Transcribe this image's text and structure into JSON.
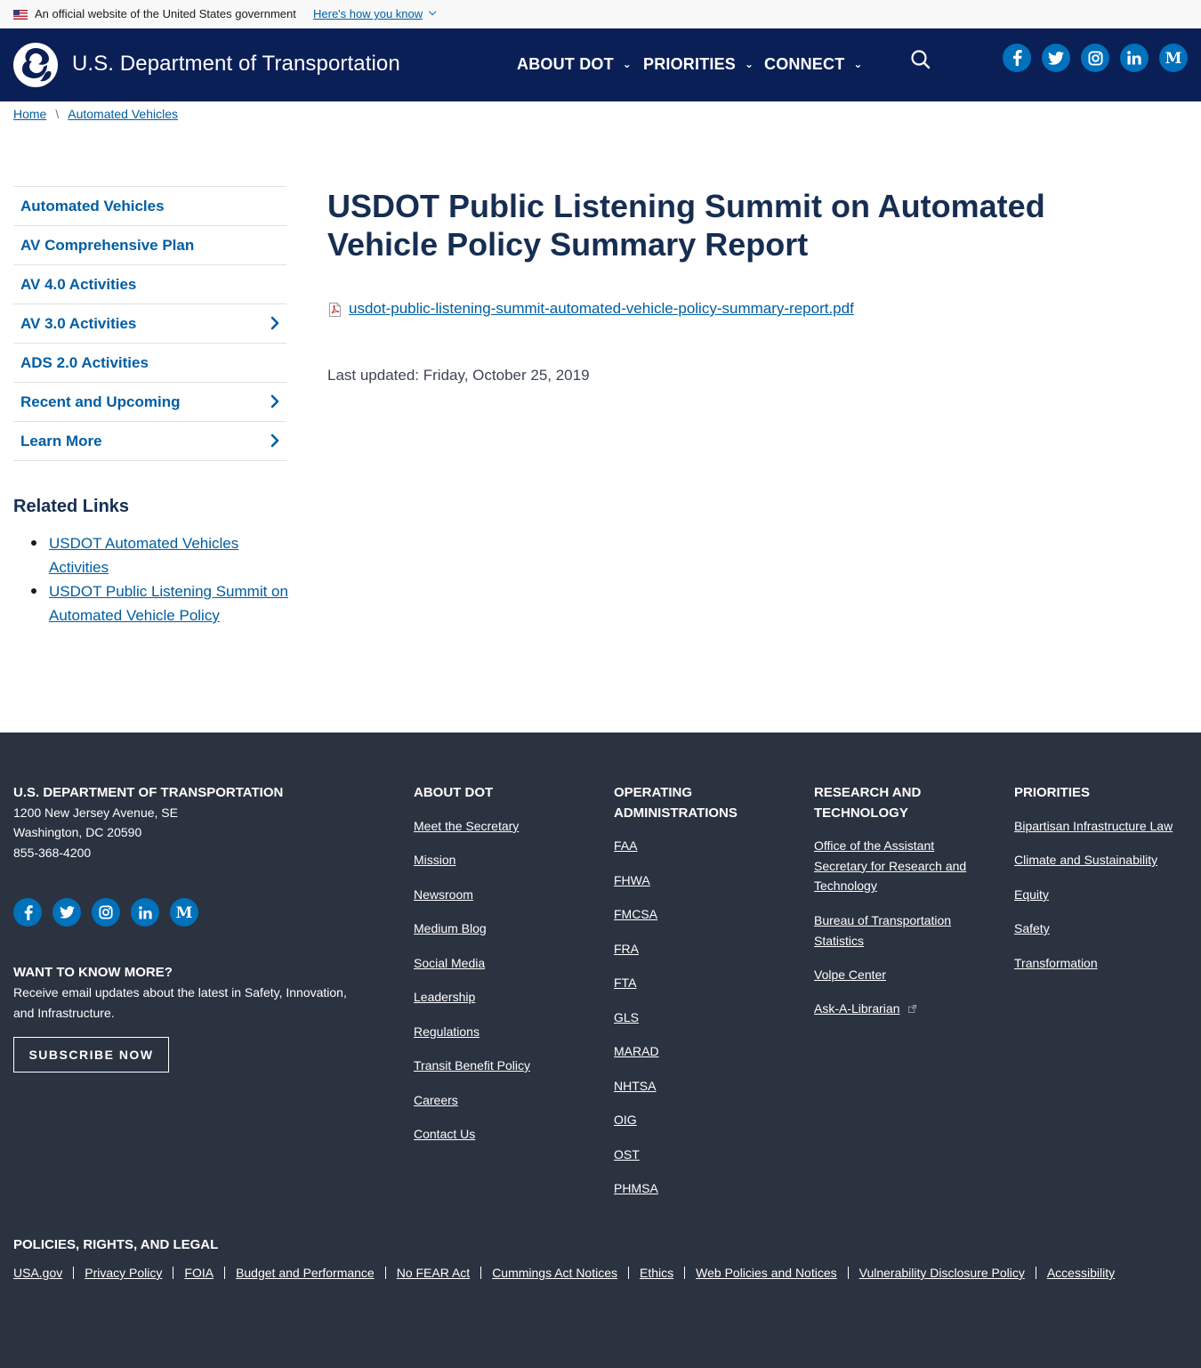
{
  "gov_banner": {
    "official_text": "An official website of the United States government",
    "how_link": "Here's how you know"
  },
  "header": {
    "site_name": "U.S. Department of Transportation",
    "nav": [
      "ABOUT DOT",
      "PRIORITIES",
      "CONNECT"
    ],
    "social": [
      "facebook-icon",
      "twitter-icon",
      "instagram-icon",
      "linkedin-icon",
      "medium-icon"
    ]
  },
  "breadcrumb": {
    "home": "Home",
    "current": "Automated Vehicles"
  },
  "sidebar": {
    "items": [
      {
        "label": "Automated Vehicles",
        "has_children": false
      },
      {
        "label": "AV Comprehensive Plan",
        "has_children": false
      },
      {
        "label": "AV 4.0 Activities",
        "has_children": false
      },
      {
        "label": "AV 3.0 Activities",
        "has_children": true
      },
      {
        "label": "ADS 2.0 Activities",
        "has_children": false
      },
      {
        "label": "Recent and Upcoming",
        "has_children": true
      },
      {
        "label": "Learn More",
        "has_children": true
      }
    ],
    "related_title": "Related Links",
    "related_links": [
      "USDOT Automated Vehicles Activities",
      "USDOT Public Listening Summit on Automated Vehicle Policy"
    ]
  },
  "main": {
    "title": "USDOT Public Listening Summit on Automated Vehicle Policy Summary Report",
    "file_link": "usdot-public-listening-summit-automated-vehicle-policy-summary-report.pdf",
    "last_updated": "Last updated: Friday, October 25, 2019"
  },
  "footer": {
    "org_title": "U.S. DEPARTMENT OF TRANSPORTATION",
    "address_line1": "1200 New Jersey Avenue, SE",
    "address_line2": "Washington, DC 20590",
    "phone": "855-368-4200",
    "want_title": "WANT TO KNOW MORE?",
    "want_text": "Receive email updates about the latest in Safety, Innovation, and Infrastructure.",
    "subscribe": "SUBSCRIBE NOW",
    "about_title": "ABOUT DOT",
    "about_links": [
      "Meet the Secretary",
      "Mission",
      "Newsroom",
      "Medium Blog",
      "Social Media",
      "Leadership",
      "Regulations",
      "Transit Benefit Policy",
      "Careers",
      "Contact Us"
    ],
    "opadmin_title": "OPERATING ADMINISTRATIONS",
    "opadmin_links": [
      "FAA",
      "FHWA",
      "FMCSA",
      "FRA",
      "FTA",
      "GLS",
      "MARAD",
      "NHTSA",
      "OIG",
      "OST",
      "PHMSA"
    ],
    "research_title": "RESEARCH AND TECHNOLOGY",
    "research_links": [
      "Office of the Assistant Secretary for Research and Technology",
      "Bureau of Transportation Statistics",
      "Volpe Center",
      "Ask-A-Librarian"
    ],
    "priorities_title": "PRIORITIES",
    "priorities_links": [
      "Bipartisan Infrastructure Law",
      "Climate and Sustainability",
      "Equity",
      "Safety",
      "Transformation"
    ],
    "legal_title": "POLICIES, RIGHTS, AND LEGAL",
    "legal_links": [
      "USA.gov",
      "Privacy Policy",
      "FOIA",
      "Budget and Performance",
      "No FEAR Act",
      "Cummings Act Notices",
      "Ethics",
      "Web Policies and Notices",
      "Vulnerability Disclosure Policy",
      "Accessibility"
    ]
  },
  "colors": {
    "header_bg": "#0b1f57",
    "footer_bg": "#2b3240",
    "link": "#005ea2",
    "title": "#162e51",
    "social": "#0071bb"
  }
}
